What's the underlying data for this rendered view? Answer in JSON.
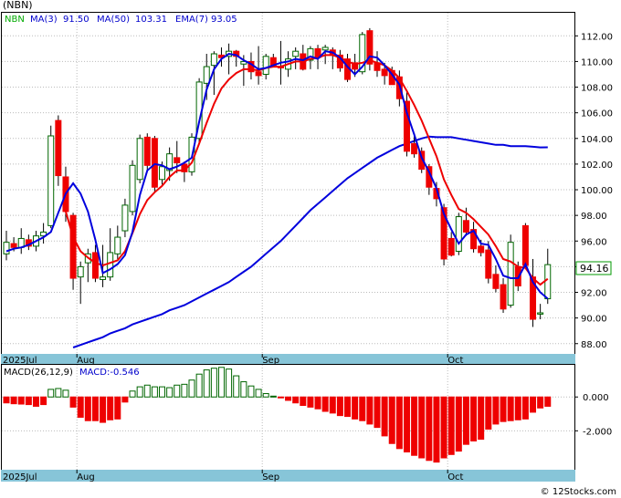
{
  "chart_data": [
    {
      "type": "candlestick",
      "title": "(NBN)",
      "legend": [
        {
          "name": "NBN",
          "value": "",
          "color": "#00aa00"
        },
        {
          "name": "MA(3)",
          "value": "91.50",
          "color": "#0000cc"
        },
        {
          "name": "MA(50)",
          "value": "103.31",
          "color": "#0000cc"
        },
        {
          "name": "EMA(7)",
          "value": "93.05",
          "color": "#0000cc"
        }
      ],
      "price_tag": "94.16",
      "ylim": [
        87.2,
        113.8
      ],
      "yticks": [
        "88.00",
        "90.00",
        "92.00",
        "94.00",
        "96.00",
        "98.00",
        "100.00",
        "102.00",
        "104.00",
        "106.00",
        "108.00",
        "110.00",
        "112.00"
      ],
      "yticks_values": [
        88,
        90,
        92,
        94,
        96,
        98,
        100,
        102,
        104,
        106,
        108,
        110,
        112
      ],
      "x_labels": [
        {
          "text": "2025Jul",
          "index": 0
        },
        {
          "text": "Aug",
          "index": 10
        },
        {
          "text": "Sep",
          "index": 35
        },
        {
          "text": "Oct",
          "index": 60
        }
      ],
      "candles": [
        [
          95.0,
          96.8,
          94.5,
          95.9
        ],
        [
          95.8,
          96.3,
          95.2,
          95.5
        ],
        [
          95.5,
          97.0,
          95.0,
          96.2
        ],
        [
          96.1,
          96.5,
          95.3,
          95.6
        ],
        [
          95.6,
          96.8,
          95.2,
          96.4
        ],
        [
          96.4,
          97.4,
          95.8,
          96.7
        ],
        [
          97.2,
          105.0,
          97.0,
          104.2
        ],
        [
          105.4,
          105.8,
          100.3,
          101.1
        ],
        [
          101.0,
          101.8,
          97.5,
          98.3
        ],
        [
          98.0,
          98.2,
          92.2,
          93.1
        ],
        [
          93.2,
          94.4,
          91.1,
          94.0
        ],
        [
          94.3,
          95.4,
          92.8,
          95.0
        ],
        [
          95.1,
          95.7,
          92.8,
          93.1
        ],
        [
          93.0,
          95.7,
          92.4,
          93.2
        ],
        [
          93.2,
          97.0,
          92.9,
          95.1
        ],
        [
          95.0,
          97.2,
          94.6,
          96.3
        ],
        [
          96.8,
          99.3,
          96.3,
          98.8
        ],
        [
          98.3,
          102.3,
          98.0,
          101.9
        ],
        [
          100.8,
          104.3,
          100.5,
          104.0
        ],
        [
          104.1,
          104.4,
          101.4,
          101.9
        ],
        [
          104.0,
          104.2,
          99.8,
          100.2
        ],
        [
          100.8,
          102.2,
          100.4,
          101.8
        ],
        [
          101.5,
          103.3,
          100.7,
          102.8
        ],
        [
          102.5,
          103.8,
          101.3,
          102.1
        ],
        [
          102.0,
          102.2,
          100.6,
          101.4
        ],
        [
          101.4,
          104.4,
          101.1,
          104.1
        ],
        [
          104.0,
          108.7,
          103.6,
          108.4
        ],
        [
          108.3,
          110.6,
          107.0,
          109.6
        ],
        [
          109.7,
          110.8,
          107.4,
          110.6
        ],
        [
          110.5,
          111.1,
          109.6,
          110.3
        ],
        [
          110.4,
          111.4,
          109.0,
          110.8
        ],
        [
          110.8,
          110.9,
          109.6,
          110.4
        ],
        [
          109.8,
          110.5,
          108.1,
          110.0
        ],
        [
          110.0,
          110.7,
          108.6,
          109.2
        ],
        [
          109.2,
          111.2,
          108.2,
          108.9
        ],
        [
          109.0,
          110.6,
          108.6,
          110.4
        ],
        [
          110.3,
          110.6,
          109.6,
          109.6
        ],
        [
          109.6,
          111.6,
          108.2,
          109.5
        ],
        [
          109.4,
          110.8,
          108.8,
          110.2
        ],
        [
          110.4,
          111.1,
          109.4,
          110.8
        ],
        [
          110.6,
          111.3,
          109.3,
          109.4
        ],
        [
          110.1,
          111.2,
          109.4,
          111.0
        ],
        [
          111.0,
          111.3,
          109.4,
          110.3
        ],
        [
          110.9,
          111.3,
          109.8,
          111.1
        ],
        [
          110.9,
          111.1,
          109.4,
          110.6
        ],
        [
          110.5,
          110.9,
          109.2,
          109.5
        ],
        [
          110.2,
          110.6,
          108.4,
          108.6
        ],
        [
          109.9,
          110.6,
          108.8,
          109.4
        ],
        [
          109.2,
          112.3,
          109.0,
          112.1
        ],
        [
          112.4,
          112.6,
          109.3,
          109.8
        ],
        [
          109.9,
          110.8,
          108.8,
          109.3
        ],
        [
          109.4,
          109.9,
          108.2,
          108.9
        ],
        [
          109.3,
          109.6,
          108.5,
          108.2
        ],
        [
          108.8,
          109.3,
          106.5,
          107.1
        ],
        [
          106.9,
          107.6,
          102.6,
          103.0
        ],
        [
          103.6,
          104.4,
          102.5,
          102.8
        ],
        [
          103.0,
          103.3,
          101.3,
          101.6
        ],
        [
          101.8,
          102.0,
          99.6,
          100.2
        ],
        [
          100.1,
          100.6,
          98.7,
          99.3
        ],
        [
          98.6,
          98.9,
          94.1,
          94.6
        ],
        [
          96.2,
          96.7,
          94.8,
          94.9
        ],
        [
          95.2,
          98.2,
          94.9,
          97.9
        ],
        [
          97.6,
          98.6,
          96.4,
          96.7
        ],
        [
          96.9,
          97.5,
          95.1,
          95.4
        ],
        [
          95.6,
          96.1,
          94.8,
          95.1
        ],
        [
          95.3,
          96.0,
          92.7,
          93.1
        ],
        [
          93.4,
          94.1,
          92.0,
          92.3
        ],
        [
          92.6,
          93.1,
          90.4,
          90.7
        ],
        [
          91.0,
          96.5,
          90.8,
          95.9
        ],
        [
          94.0,
          94.4,
          92.1,
          92.5
        ],
        [
          97.2,
          97.4,
          93.9,
          94.1
        ],
        [
          93.2,
          94.6,
          89.3,
          89.9
        ],
        [
          90.3,
          91.1,
          89.9,
          90.4
        ],
        [
          91.5,
          95.4,
          91.1,
          94.16
        ]
      ],
      "ema7": [
        95.2,
        95.3,
        95.5,
        95.6,
        95.8,
        96.0,
        96.6,
        97.5,
        98.3,
        96.3,
        95.2,
        94.7,
        94.3,
        94.1,
        94.3,
        94.5,
        95.2,
        96.6,
        98.1,
        99.2,
        99.8,
        100.3,
        101.0,
        101.5,
        101.5,
        102.1,
        103.6,
        105.2,
        106.7,
        107.9,
        108.6,
        109.1,
        109.4,
        109.4,
        109.3,
        109.5,
        109.6,
        109.6,
        109.8,
        110.0,
        110.0,
        110.2,
        110.3,
        110.5,
        110.5,
        110.3,
        110.0,
        109.8,
        109.9,
        110.1,
        109.9,
        109.7,
        109.3,
        108.7,
        107.7,
        106.6,
        105.4,
        104.0,
        102.6,
        100.8,
        99.6,
        98.5,
        98.2,
        97.7,
        97.1,
        96.5,
        95.6,
        94.6,
        94.4,
        94.0,
        93.9,
        93.1,
        92.6,
        93.05
      ],
      "ma3": [
        95.2,
        95.4,
        95.5,
        95.7,
        96.0,
        96.3,
        96.7,
        98.2,
        99.7,
        100.5,
        99.7,
        98.3,
        96.1,
        93.5,
        93.8,
        94.2,
        94.9,
        96.7,
        99.6,
        101.5,
        102.0,
        101.9,
        101.6,
        101.8,
        102.1,
        102.5,
        105.3,
        107.8,
        109.4,
        110.2,
        110.6,
        110.5,
        110.1,
        109.8,
        109.4,
        109.5,
        109.7,
        109.9,
        110.0,
        110.2,
        110.1,
        110.4,
        110.2,
        110.8,
        110.7,
        110.3,
        109.6,
        109.0,
        109.6,
        110.4,
        110.3,
        109.7,
        109.0,
        108.2,
        106.0,
        104.3,
        102.5,
        101.4,
        100.1,
        98.1,
        96.9,
        95.8,
        96.5,
        96.8,
        95.8,
        95.7,
        94.6,
        93.3,
        93.1,
        93.1,
        94.2,
        92.8,
        92.0,
        91.5
      ],
      "ma50": [
        87.7,
        87.9,
        88.1,
        88.3,
        88.5,
        88.8,
        89.0,
        89.2,
        89.5,
        89.7,
        89.9,
        90.1,
        90.3,
        90.6,
        90.8,
        91.0,
        91.3,
        91.6,
        91.9,
        92.2,
        92.5,
        92.8,
        93.2,
        93.6,
        94.0,
        94.5,
        95.0,
        95.5,
        96.0,
        96.6,
        97.2,
        97.8,
        98.4,
        98.9,
        99.4,
        99.9,
        100.4,
        100.9,
        101.3,
        101.7,
        102.1,
        102.5,
        102.8,
        103.1,
        103.4,
        103.6,
        103.8,
        104.0,
        104.15,
        104.1,
        104.1,
        104.1,
        104.0,
        103.9,
        103.8,
        103.7,
        103.6,
        103.5,
        103.5,
        103.4,
        103.4,
        103.4,
        103.35,
        103.3,
        103.31
      ],
      "ma50_start_index": 9,
      "macd": {
        "label": "MACD(26,12,9)",
        "value_label": "MACD:-0.546",
        "ylim": [
          -4.3,
          1.9
        ],
        "yticks": [
          "0.000",
          "-2.000"
        ],
        "yticks_values": [
          0,
          -2
        ],
        "values": [
          -0.35,
          -0.4,
          -0.42,
          -0.45,
          -0.55,
          -0.45,
          0.45,
          0.5,
          0.4,
          -0.6,
          -1.2,
          -1.4,
          -1.4,
          -1.5,
          -1.35,
          -1.3,
          -0.3,
          0.35,
          0.6,
          0.7,
          0.6,
          0.6,
          0.55,
          0.7,
          0.75,
          1.0,
          1.35,
          1.6,
          1.7,
          1.75,
          1.65,
          1.25,
          0.9,
          0.65,
          0.45,
          0.2,
          0.05,
          -0.05,
          -0.2,
          -0.35,
          -0.5,
          -0.6,
          -0.7,
          -0.85,
          -0.95,
          -1.1,
          -1.15,
          -1.3,
          -1.4,
          -1.6,
          -1.8,
          -2.3,
          -2.75,
          -3.05,
          -3.25,
          -3.45,
          -3.6,
          -3.75,
          -3.85,
          -3.6,
          -3.4,
          -3.2,
          -2.8,
          -2.6,
          -2.5,
          -1.9,
          -1.6,
          -1.45,
          -1.4,
          -1.35,
          -1.3,
          -0.9,
          -0.65,
          -0.55
        ]
      }
    }
  ]
}
